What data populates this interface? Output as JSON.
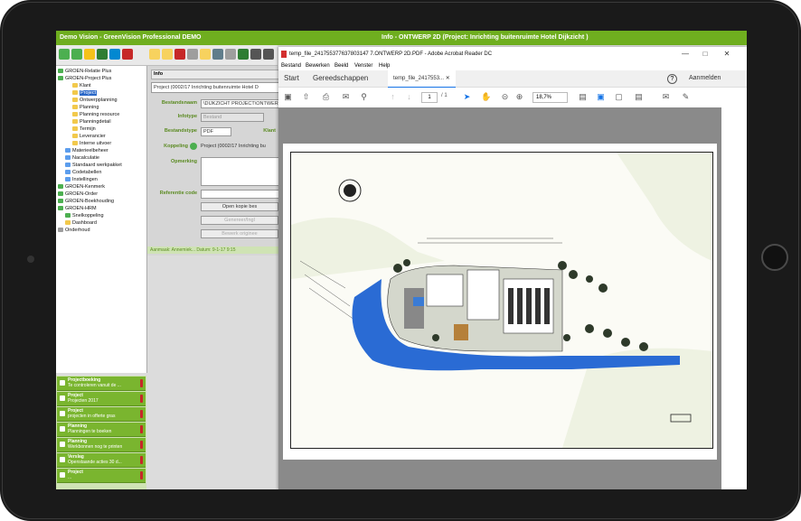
{
  "app": {
    "title": "Demo Vision - GreenVision Professional DEMO",
    "window_title": "Info - ONTWERP 2D (Project: Inrichting buitenruimte Hotel Dijkzicht )"
  },
  "tree": [
    {
      "label": "GROEN-Relatie Plus"
    },
    {
      "label": "GROEN-Project Plus"
    },
    {
      "label": "Klant"
    },
    {
      "label": "Project"
    },
    {
      "label": "Ontwerpplanning"
    },
    {
      "label": "Planning"
    },
    {
      "label": "Planning resource"
    },
    {
      "label": "Planningdetail"
    },
    {
      "label": "Termijn"
    },
    {
      "label": "Leverancier"
    },
    {
      "label": "Interne uitvoer"
    },
    {
      "label": "Materieelbeheer"
    },
    {
      "label": "Nacalculatie"
    },
    {
      "label": "Standaard werkpakket"
    },
    {
      "label": "Codetabellen"
    },
    {
      "label": "Instellingen"
    },
    {
      "label": "GROEN-Kenmerk"
    },
    {
      "label": "GROEN-Order"
    },
    {
      "label": "GROEN-Boekhouding"
    },
    {
      "label": "GROEN-HRM"
    },
    {
      "label": "Snelkoppeling"
    },
    {
      "label": "Dashboard"
    },
    {
      "label": "Onderhoud"
    }
  ],
  "tasks": [
    {
      "title": "Projectboeking",
      "subtitle": "Te controleren vanuit de ..."
    },
    {
      "title": "Project",
      "subtitle": "Projecten 2017"
    },
    {
      "title": "Project",
      "subtitle": "projecten in offerte gras"
    },
    {
      "title": "Planning",
      "subtitle": "Planningen te boeken"
    },
    {
      "title": "Planning",
      "subtitle": "Werkbonnen nog te printen"
    },
    {
      "title": "Verslag",
      "subtitle": "Openstaande acties 30 d..."
    },
    {
      "title": "Project",
      "subtitle": "..."
    }
  ],
  "form": {
    "info_label": "Info",
    "project_value": "Project (0002/17 Inrichting buitenruimte Hotel D",
    "bestandsnaam_label": "Bestandsnaam",
    "bestandsnaam_value": "\\DIJKZICHT PROJECT\\ONTWER",
    "infotype_label": "Infotype",
    "infotype_value": "Bestand",
    "bestandstype_label": "Bestandstype",
    "bestandstype_value": "PDF",
    "klant_label": "Klant",
    "koppeling_label": "Koppeling",
    "koppeling_value": "Project (0002/17 Inrichting bu",
    "opmerking_label": "Opmerking",
    "referentie_label": "Referentie code",
    "btn_open": "Open kopie bes",
    "btn_genereer": "Genereer/Ingl",
    "btn_bewerk": "Bewerk originee"
  },
  "statusbar": {
    "text": "Aanmaak: Annemiek...   Datum: 9-1-17 9:15"
  },
  "acrobat": {
    "title": "temp_file_241755377637803147 7.ONTWERP 2D.PDF - Adobe Acrobat Reader DC",
    "menu": [
      "Bestand",
      "Bewerken",
      "Beeld",
      "Venster",
      "Help"
    ],
    "tab_start": "Start",
    "tab_tools": "Gereedschappen",
    "tab_doc": "temp_file_2417553...",
    "signin": "Aanmelden",
    "page_number": "1",
    "page_total": "/ 1",
    "zoom": "18,7%"
  }
}
